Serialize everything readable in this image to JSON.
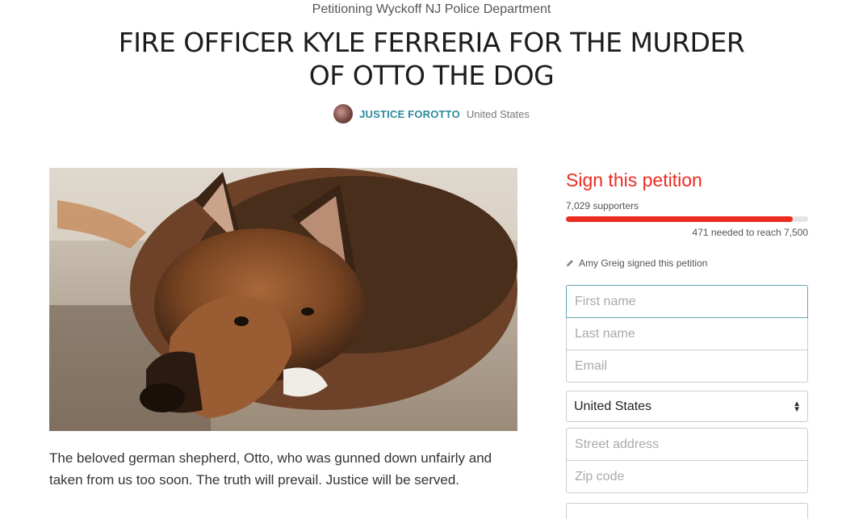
{
  "petition": {
    "target": "Petitioning Wyckoff NJ Police Department",
    "title_line1": "FIRE OFFICER KYLE FERRERIA FOR THE MURDER",
    "title_line2": "OF OTTO THE DOG",
    "starter_name": "JUSTICE FOROTTO",
    "starter_location": "United States",
    "description": "The beloved german shepherd, Otto, who was gunned down unfairly and taken from us too soon. The truth will prevail. Justice will be served."
  },
  "sign": {
    "heading": "Sign this petition",
    "supporters": "7,029 supporters",
    "progress_fraction": 0.937,
    "needed": "471 needed to reach 7,500",
    "recent_signer": "Amy Greig signed this petition"
  },
  "form": {
    "first_name_placeholder": "First name",
    "last_name_placeholder": "Last name",
    "email_placeholder": "Email",
    "country": "United States",
    "street_placeholder": "Street address",
    "zip_placeholder": "Zip code"
  },
  "colors": {
    "accent": "#ec2c22",
    "link": "#2d8a9c",
    "focus_border": "#5fa6b5"
  }
}
